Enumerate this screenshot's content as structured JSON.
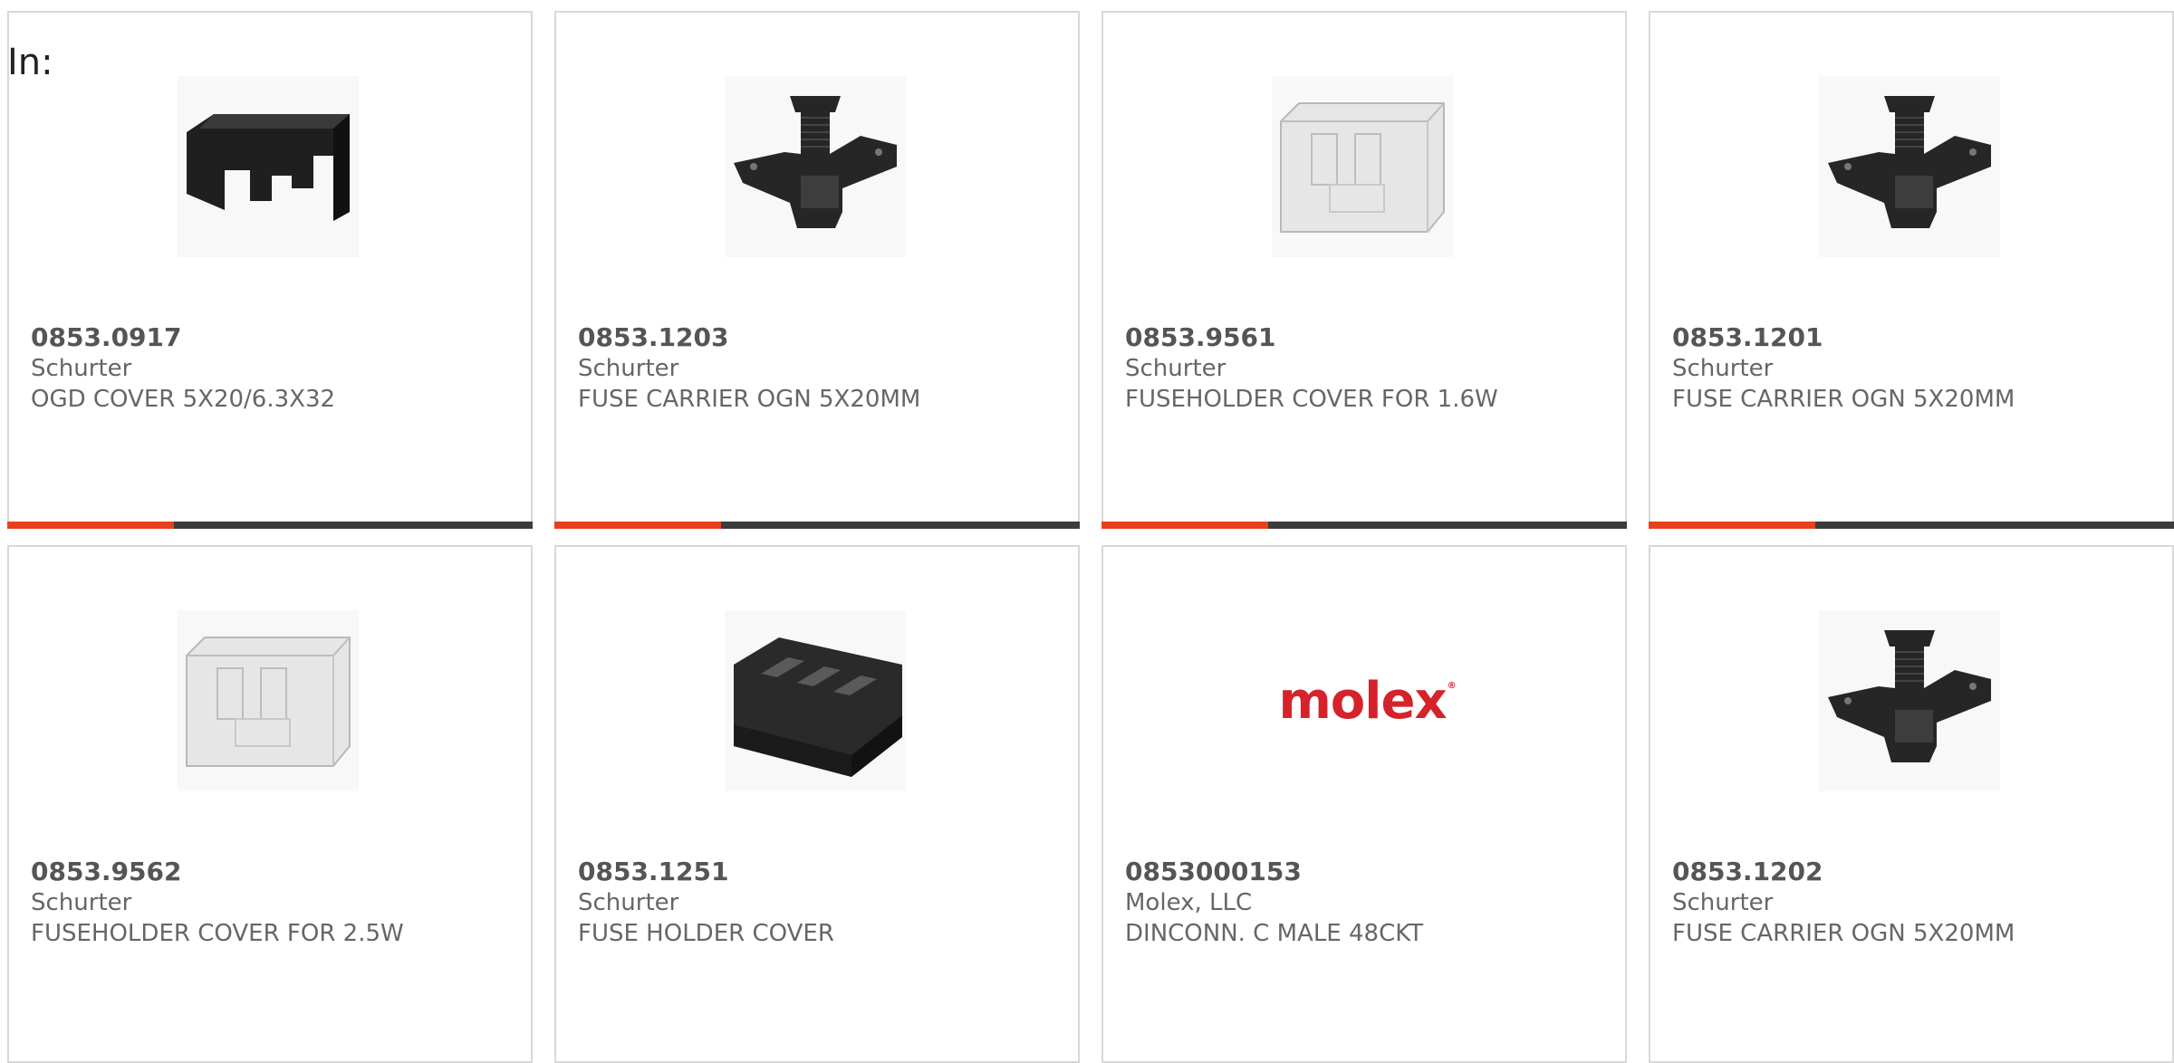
{
  "filter": {
    "label": "In:"
  },
  "products": [
    {
      "part_number": "0853.0917",
      "manufacturer": "Schurter",
      "description": "OGD COVER 5X20/6.3X32",
      "image_icon": "black-cover-icon",
      "has_progress_bar": true
    },
    {
      "part_number": "0853.1203",
      "manufacturer": "Schurter",
      "description": "FUSE CARRIER OGN 5X20MM",
      "image_icon": "fuse-carrier-icon",
      "has_progress_bar": true
    },
    {
      "part_number": "0853.9561",
      "manufacturer": "Schurter",
      "description": "FUSEHOLDER COVER FOR 1.6W",
      "image_icon": "clear-cover-icon",
      "has_progress_bar": true
    },
    {
      "part_number": "0853.1201",
      "manufacturer": "Schurter",
      "description": "FUSE CARRIER OGN 5X20MM",
      "image_icon": "fuse-carrier-icon",
      "has_progress_bar": true
    },
    {
      "part_number": "0853.9562",
      "manufacturer": "Schurter",
      "description": "FUSEHOLDER COVER FOR 2.5W",
      "image_icon": "clear-cover-icon",
      "has_progress_bar": false
    },
    {
      "part_number": "0853.1251",
      "manufacturer": "Schurter",
      "description": "FUSE HOLDER COVER",
      "image_icon": "fuse-holder-cover-icon",
      "has_progress_bar": false
    },
    {
      "part_number": "0853000153",
      "manufacturer": "Molex, LLC",
      "description": "DINCONN. C MALE 48CKT",
      "image_icon": "molex-logo",
      "logo_text": "molex",
      "has_progress_bar": false
    },
    {
      "part_number": "0853.1202",
      "manufacturer": "Schurter",
      "description": "FUSE CARRIER OGN 5X20MM",
      "image_icon": "fuse-carrier-icon",
      "has_progress_bar": false
    }
  ],
  "colors": {
    "accent": "#e8401c",
    "bar_dark": "#3c3c3c",
    "card_border": "#d8d8d8",
    "text": "#666666",
    "molex_red": "#d6222b"
  }
}
